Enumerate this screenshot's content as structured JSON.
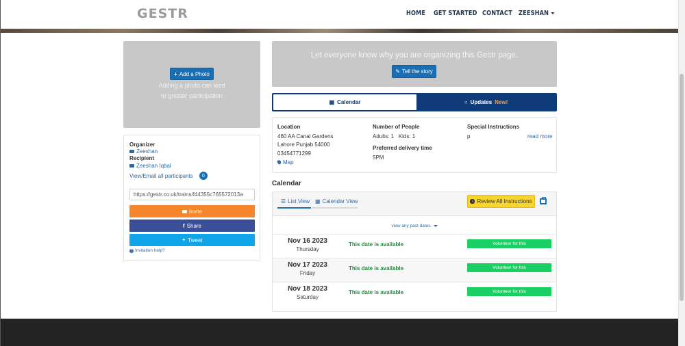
{
  "nav": {
    "logo": "GESTR",
    "items": [
      "HOME",
      "GET STARTED",
      "CONTACT",
      "ZEESHAN"
    ]
  },
  "photo": {
    "button_label": "Add a Photo",
    "hint_line1": "Adding a photo can lead",
    "hint_line2": "to greater participation"
  },
  "organizer": {
    "organizer_label": "Organizer",
    "organizer_name": "Zeeshan",
    "recipient_label": "Recipient",
    "recipient_name": "Zeeshan Iqbal",
    "participants_link": "View/Email all participants",
    "participants_count": "0",
    "share_url": "https://gestr.co.uk/trains/f44355c765572013a",
    "invite_label": "Invite",
    "share_label": "Share",
    "tweet_label": "Tweet",
    "help_label": "Invitation help?"
  },
  "story": {
    "prompt": "Let everyone know why you are organizing this Gestr page.",
    "button_label": "Tell the story"
  },
  "tabs": {
    "calendar": "Calendar",
    "updates": "Updates",
    "updates_new": "New!"
  },
  "details": {
    "location_label": "Location",
    "address1": "460 AA Canal Gardens",
    "address2": "Lahore Punjab 54000",
    "phone": "03454771299",
    "map_link": "Map",
    "people_label": "Number of People",
    "people_value": "Adults: 1   Kids: 1",
    "delivery_label": "Preferred delivery time",
    "delivery_value": "5PM",
    "instructions_label": "Special Instructions",
    "instructions_value": "p",
    "read_more": "read more"
  },
  "calendar": {
    "heading": "Calendar",
    "list_view": "List View",
    "calendar_view": "Calendar View",
    "review_button": "Review All Instructions",
    "past_dates": "view any past dates",
    "rows": [
      {
        "date": "Nov 16 2023",
        "day": "Thursday",
        "status": "This date is available",
        "action": "Volunteer for this"
      },
      {
        "date": "Nov 17 2023",
        "day": "Friday",
        "status": "This date is available",
        "action": "Volunteer for this"
      },
      {
        "date": "Nov 18 2023",
        "day": "Saturday",
        "status": "This date is available",
        "action": "Volunteer for this"
      }
    ]
  },
  "colors": {
    "primary_blue": "#1a6fb4",
    "navy": "#0f3b78",
    "invite_orange": "#f5862c",
    "facebook": "#3b4f99",
    "twitter": "#10a5e8",
    "available_green": "#1e8a3c",
    "volunteer_green": "#1ccf62",
    "review_yellow": "#f7d52c"
  },
  "icons": [
    "plus-icon",
    "pencil-icon",
    "calendar-icon",
    "comment-icon",
    "envelope-icon",
    "map-marker-icon",
    "list-icon",
    "info-icon",
    "print-icon",
    "facebook-icon",
    "twitter-icon",
    "question-icon",
    "caret-down-icon"
  ]
}
